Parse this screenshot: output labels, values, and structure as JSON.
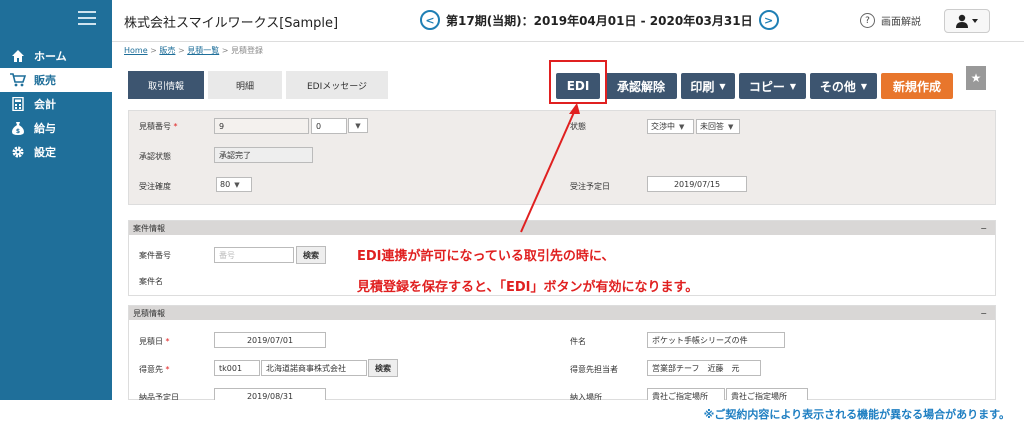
{
  "app": {
    "title": "株式会社スマイルワークス[Sample]"
  },
  "period": {
    "text": "第17期(当期)：2019年04月01日 - 2020年03月31日",
    "prev_icon": "chevron-left-icon",
    "next_icon": "chevron-right-icon"
  },
  "help": {
    "label": "画面解説"
  },
  "sidebar": {
    "items": [
      {
        "label": "ホーム",
        "icon": "home-icon"
      },
      {
        "label": "販売",
        "icon": "cart-icon"
      },
      {
        "label": "会計",
        "icon": "calculator-icon"
      },
      {
        "label": "給与",
        "icon": "moneybag-icon"
      },
      {
        "label": "設定",
        "icon": "gear-icon"
      }
    ]
  },
  "breadcrumb": {
    "home": "Home",
    "sales": "販売",
    "list": "見積一覧",
    "current": "見積登録",
    "sep": ">"
  },
  "tabs": [
    {
      "label": "取引情報"
    },
    {
      "label": "明細"
    },
    {
      "label": "EDIメッセージ"
    }
  ],
  "actions": {
    "edi": "EDI",
    "unapprove": "承認解除",
    "print": "印刷",
    "copy": "コピー",
    "other": "その他",
    "new": "新規作成",
    "caret": "▼"
  },
  "form_top": {
    "quote_no_label": "見積番号",
    "required_mark": "*",
    "quote_no": "9",
    "quote_sub": "0",
    "approval_label": "承認状態",
    "approval_value": "承認完了",
    "certainty_label": "受注確度",
    "certainty_value": "80",
    "status_label": "状態",
    "status_1": "交渉中",
    "status_2": "未回答",
    "order_date_label": "受注予定日",
    "order_date": "2019/07/15"
  },
  "case_panel": {
    "title": "案件情報",
    "minimize": "−",
    "no_label": "案件番号",
    "no_placeholder": "番号",
    "search": "検索",
    "name_label": "案件名"
  },
  "quote_panel": {
    "title": "見積情報",
    "minimize": "−",
    "date_label": "見積日",
    "date": "2019/07/01",
    "client_label": "得意先",
    "client_code": "tk001",
    "client_name": "北海道諾商事株式会社",
    "search": "検索",
    "delivery_label": "納品予定日",
    "delivery": "2019/08/31",
    "subject_label": "件名",
    "subject": "ポケット手帳シリーズの件",
    "contact_label": "得意先担当者",
    "contact": "営業部チーフ　近藤　元",
    "place_label": "納入場所",
    "place_1": "貴社ご指定場所",
    "place_2": "貴社ご指定場所"
  },
  "annotation": {
    "line1": "EDI連携が許可になっている取引先の時に、",
    "line2": "見積登録を保存すると、「EDI」ボタンが有効になります。",
    "color": "#e02020"
  },
  "footer_note": "※ご契約内容により表示される機能が異なる場合があります。"
}
